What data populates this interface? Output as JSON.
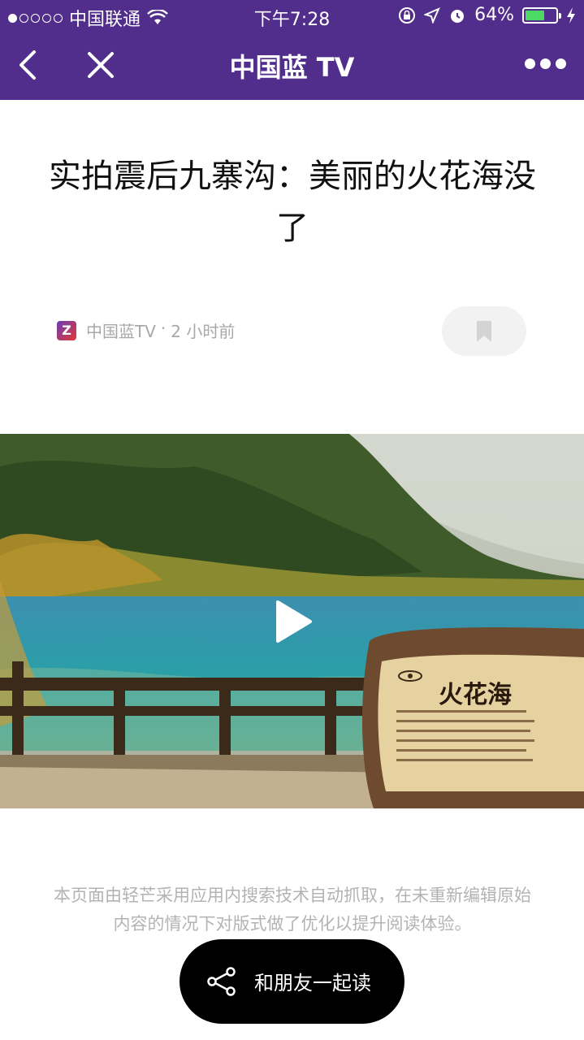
{
  "status_bar": {
    "carrier": "中国联通",
    "time": "下午7:28",
    "battery_percent": "64%",
    "battery_level": 0.64,
    "battery_color": "#4cd964",
    "icons": [
      "signal-dots-icon",
      "wifi-icon",
      "rotation-lock-icon",
      "location-arrow-icon",
      "alarm-icon",
      "battery-icon",
      "charging-bolt-icon"
    ]
  },
  "nav": {
    "title": "中国蓝 TV",
    "bar_color": "#512d8c",
    "icons": [
      "back-chevron-icon",
      "close-icon",
      "more-dots-icon"
    ]
  },
  "article": {
    "title": "实拍震后九寨沟：美丽的火花海没了",
    "source": "中国蓝TV",
    "separator": "·",
    "time_ago": "2 小时前",
    "logo_letter": "Z"
  },
  "video": {
    "sign_text": "火花海",
    "play_icon": "play-icon"
  },
  "disclaimer": "本页面由轻芒采用应用内搜索技术自动抓取，在未重新编辑原始内容的情况下对版式做了优化以提升阅读体验。",
  "share": {
    "label": "和朋友一起读",
    "icon": "share-icon"
  }
}
